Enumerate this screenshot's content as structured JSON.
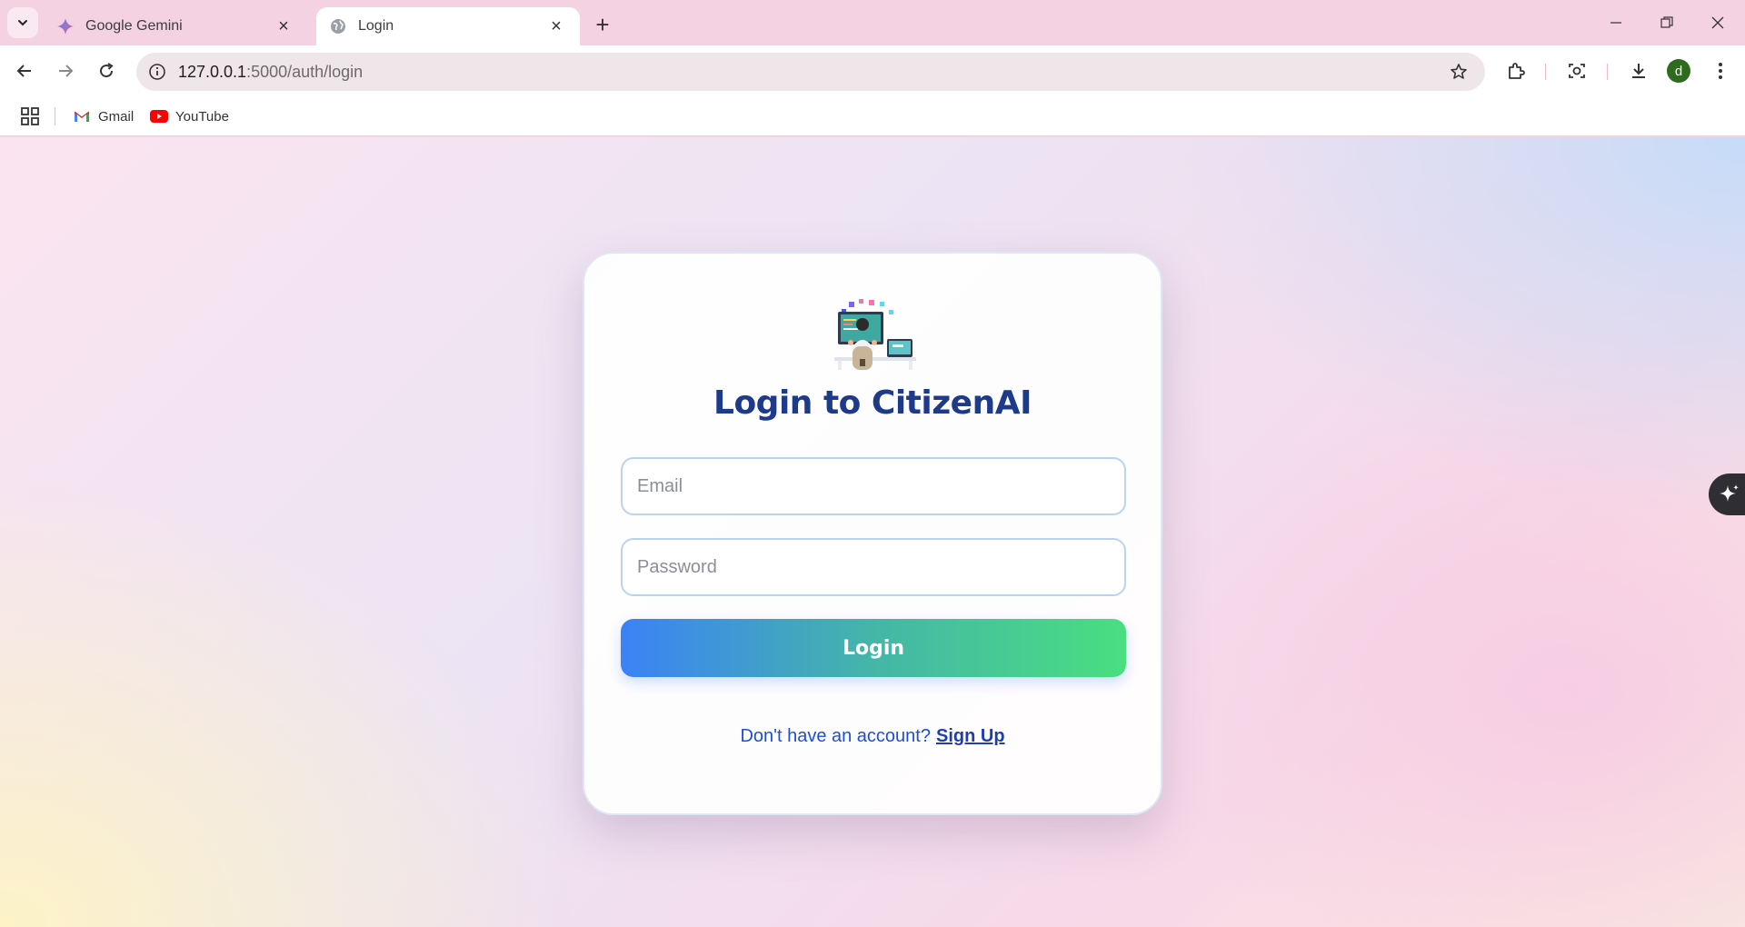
{
  "browser": {
    "tabs": [
      {
        "title": "Google Gemini",
        "icon": "gemini-icon",
        "active": false
      },
      {
        "title": "Login",
        "icon": "globe-icon",
        "active": true
      }
    ],
    "address": {
      "host": "127.0.0.1",
      "path": ":5000/auth/login"
    },
    "profile_initial": "d",
    "bookmarks": [
      {
        "label": "Gmail",
        "icon": "gmail-icon"
      },
      {
        "label": "YouTube",
        "icon": "youtube-icon"
      }
    ]
  },
  "login": {
    "title": "Login to CitizenAI",
    "email_placeholder": "Email",
    "password_placeholder": "Password",
    "submit_label": "Login",
    "signup_prompt": "Don't have an account?",
    "signup_link": "Sign Up"
  },
  "colors": {
    "title": "#1e3a8a",
    "button_gradient_start": "#3b82f6",
    "button_gradient_end": "#4ade80",
    "link": "#1e40af"
  }
}
